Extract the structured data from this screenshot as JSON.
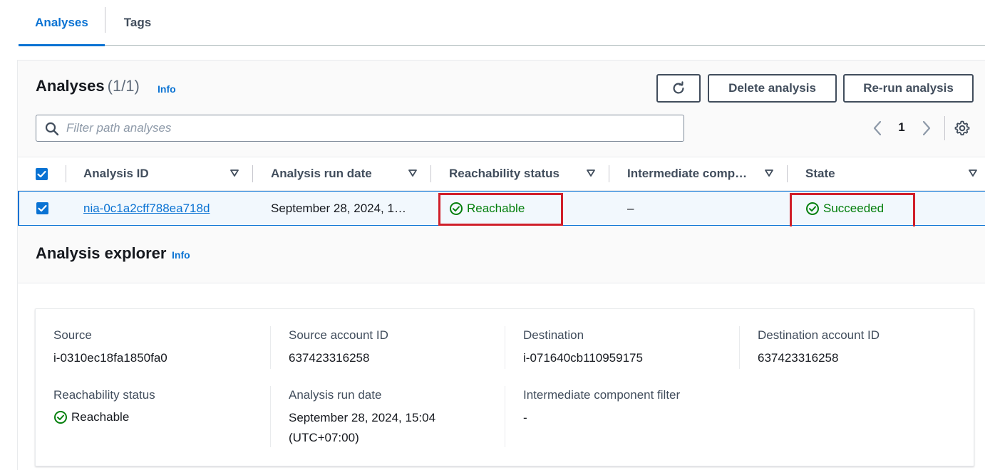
{
  "tabs": [
    {
      "label": "Analyses",
      "active": true
    },
    {
      "label": "Tags",
      "active": false
    }
  ],
  "header": {
    "title": "Analyses",
    "count": "(1/1)",
    "info": "Info",
    "delete_label": "Delete analysis",
    "rerun_label": "Re-run analysis"
  },
  "filter": {
    "placeholder": "Filter path analyses"
  },
  "pagination": {
    "current_page": "1"
  },
  "table": {
    "columns": [
      "Analysis ID",
      "Analysis run date",
      "Reachability status",
      "Intermediate comp…",
      "State"
    ],
    "rows": [
      {
        "analysis_id": "nia-0c1a2cff788ea718d",
        "run_date": "September 28, 2024, 1…",
        "reachability_status": "Reachable",
        "intermediate": "–",
        "state": "Succeeded",
        "selected": true
      }
    ]
  },
  "explorer": {
    "title": "Analysis explorer",
    "info": "Info",
    "fields": {
      "source": {
        "label": "Source",
        "value": "i-0310ec18fa1850fa0"
      },
      "source_account": {
        "label": "Source account ID",
        "value": "637423316258"
      },
      "destination": {
        "label": "Destination",
        "value": "i-071640cb110959175"
      },
      "destination_account": {
        "label": "Destination account ID",
        "value": "637423316258"
      },
      "reachability": {
        "label": "Reachability status",
        "value": "Reachable"
      },
      "run_date": {
        "label": "Analysis run date",
        "value_line1": "September 28, 2024, 15:04",
        "value_line2": "(UTC+07:00)"
      },
      "intermediate": {
        "label": "Intermediate component filter",
        "value": "-"
      }
    }
  },
  "colors": {
    "accent": "#0972d3",
    "success": "#037f0c",
    "highlight": "#d01f2a"
  },
  "icons": {
    "refresh": "refresh-icon",
    "search": "search-icon",
    "prev": "chevron-left-icon",
    "next": "chevron-right-icon",
    "settings": "gear-icon",
    "sort": "caret-down-icon",
    "status": "check-circle-icon",
    "checkbox": "checkmark-icon"
  }
}
